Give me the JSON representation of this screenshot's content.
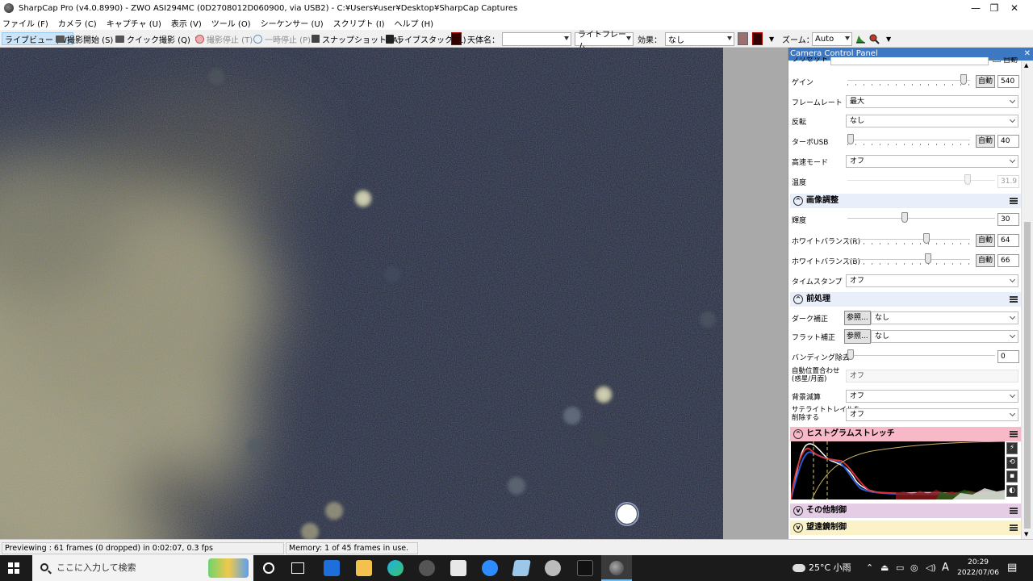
{
  "window": {
    "title": "SharpCap Pro (v4.0.8990) - ZWO ASI294MC (0D2708012D060900, via USB2) - C:¥Users¥user¥Desktop¥SharpCap Captures",
    "min": "—",
    "max": "❐",
    "close": "✕"
  },
  "menu": [
    "ファイル (F)",
    "カメラ (C)",
    "キャプチャ (U)",
    "表示 (V)",
    "ツール (O)",
    "シーケンサー (U)",
    "スクリプト (I)",
    "ヘルプ (H)"
  ],
  "toolbar": {
    "live_view": "ライブビュー (W)",
    "start_capture": "撮影開始 (S)",
    "quick_capture": "クイック撮影 (Q)",
    "stop_capture": "撮影停止 (T)",
    "pause": "一時停止 (P)",
    "snapshot": "スナップショット (A)",
    "live_stack": "ライブスタック (L)",
    "object_label": "天体名：",
    "object_value": "",
    "frame_type": "ライトフレーム",
    "effect_label": "効果：",
    "effect_value": "なし",
    "zoom_label": "ズーム：",
    "zoom_value": "Auto"
  },
  "panel": {
    "title": "Camera Control Panel",
    "close": "✕",
    "preset_partial": "プリセット",
    "preset_auto": "自動",
    "camera": {
      "gain": {
        "label": "ゲイン",
        "auto": "自動",
        "value": "540",
        "level": 0.97
      },
      "frame_rate": {
        "label": "フレームレート",
        "value": "最大"
      },
      "flip": {
        "label": "反転",
        "value": "なし"
      },
      "turbo_usb": {
        "label": "ターボUSB",
        "auto": "自動",
        "value": "40",
        "level": 0.0
      },
      "high_speed": {
        "label": "高速モード",
        "value": "オフ"
      },
      "temperature": {
        "label": "温度",
        "value": "31.9",
        "level": 0.83
      }
    },
    "image_controls": {
      "header": "画像調整",
      "brightness": {
        "label": "輝度",
        "value": "30",
        "level": 0.38
      },
      "wb_red": {
        "label": "ホワイトバランス(R)",
        "auto": "自動",
        "value": "64",
        "level": 0.65
      },
      "wb_blue": {
        "label": "ホワイトバランス(B)",
        "auto": "自動",
        "value": "66",
        "level": 0.67
      },
      "timestamp": {
        "label": "タイムスタンプ",
        "value": "オフ"
      }
    },
    "preprocessing": {
      "header": "前処理",
      "dark": {
        "label": "ダーク補正",
        "browse": "参照...",
        "value": "なし"
      },
      "flat": {
        "label": "フラット補正",
        "browse": "参照...",
        "value": "なし"
      },
      "banding": {
        "label": "バンディング除去",
        "value": "0",
        "level": 0.0
      },
      "auto_align": {
        "label1": "自動位置合わせ",
        "label2": "(惑星/月面)",
        "value": "オフ"
      },
      "background": {
        "label": "背景減算",
        "value": "オフ"
      },
      "satellite": {
        "label1": "サテライトトレイルを",
        "label2": "削除する",
        "value": "オフ"
      }
    },
    "histogram": {
      "header": "ヒストグラムストレッチ"
    },
    "misc": {
      "header": "その他制御"
    },
    "telescope": {
      "header": "望遠鏡制御"
    }
  },
  "status": {
    "previewing": "Previewing : 61 frames (0 dropped) in 0:02:07, 0.3 fps",
    "memory": "Memory: 1 of 45 frames in use."
  },
  "taskbar": {
    "search_placeholder": "ここに入力して検索",
    "weather": "25°C 小雨",
    "ime": "A",
    "time": "20:29",
    "date": "2022/07/06"
  },
  "colors": {
    "panel_header": "#3c78c3",
    "section_image": "#e9eefb",
    "section_preproc": "#e9eefb",
    "section_histo": "#f7b8c8",
    "section_misc": "#e6cde6",
    "section_scope": "#fbf3c7"
  }
}
